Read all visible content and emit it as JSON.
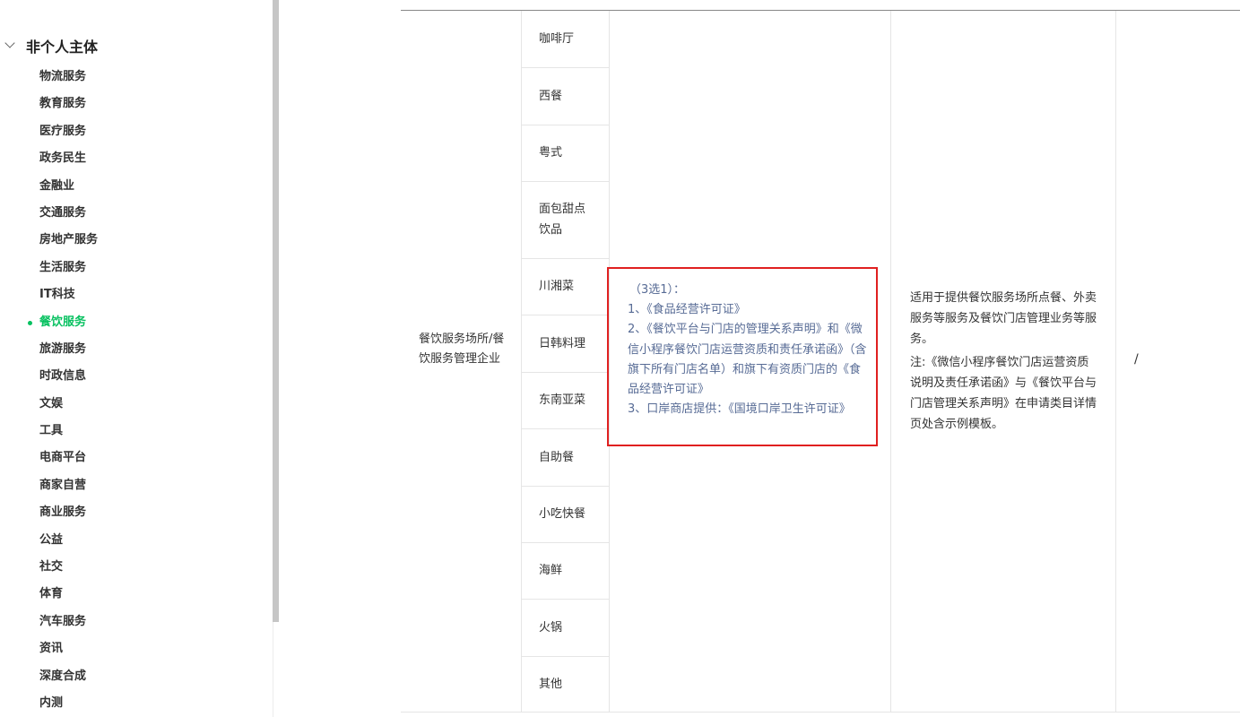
{
  "sidebar": {
    "group_title": "非个人主体",
    "items": [
      {
        "label": "物流服务",
        "active": false
      },
      {
        "label": "教育服务",
        "active": false
      },
      {
        "label": "医疗服务",
        "active": false
      },
      {
        "label": "政务民生",
        "active": false
      },
      {
        "label": "金融业",
        "active": false
      },
      {
        "label": "交通服务",
        "active": false
      },
      {
        "label": "房地产服务",
        "active": false
      },
      {
        "label": "生活服务",
        "active": false
      },
      {
        "label": "IT科技",
        "active": false
      },
      {
        "label": "餐饮服务",
        "active": true
      },
      {
        "label": "旅游服务",
        "active": false
      },
      {
        "label": "时政信息",
        "active": false
      },
      {
        "label": "文娱",
        "active": false
      },
      {
        "label": "工具",
        "active": false
      },
      {
        "label": "电商平台",
        "active": false
      },
      {
        "label": "商家自营",
        "active": false
      },
      {
        "label": "商业服务",
        "active": false
      },
      {
        "label": "公益",
        "active": false
      },
      {
        "label": "社交",
        "active": false
      },
      {
        "label": "体育",
        "active": false
      },
      {
        "label": "汽车服务",
        "active": false
      },
      {
        "label": "资讯",
        "active": false
      },
      {
        "label": "深度合成",
        "active": false
      },
      {
        "label": "内测",
        "active": false
      }
    ]
  },
  "table": {
    "main_category": "餐饮服务场所/餐饮服务管理企业",
    "subcategories": [
      "咖啡厅",
      "西餐",
      "粤式",
      "面包甜点饮品",
      "川湘菜",
      "日韩料理",
      "东南亚菜",
      "自助餐",
      "小吃快餐",
      "海鲜",
      "火锅",
      "其他"
    ],
    "qualification_lines": [
      "（3选1）：",
      "1、《食品经营许可证》",
      "2、《餐饮平台与门店的管理关系声明》和《微信小程序餐饮门店运营资质和责任承诺函》（含旗下所有门店名单）和旗下有资质门店的《食品经营许可证》",
      "3、口岸商店提供：《国境口岸卫生许可证》"
    ],
    "description": "适用于提供餐饮服务场所点餐、外卖服务等服务及餐饮门店管理业务等服务。",
    "note": "注:《微信小程序餐饮门店运营资质说明及责任承诺函》与《餐饮平台与门店管理关系声明》在申请类目详情页处含示例模板。",
    "last_column": "/"
  },
  "colors": {
    "accent": "#07c160",
    "link": "#576b95",
    "highlight_border": "#e02020"
  }
}
